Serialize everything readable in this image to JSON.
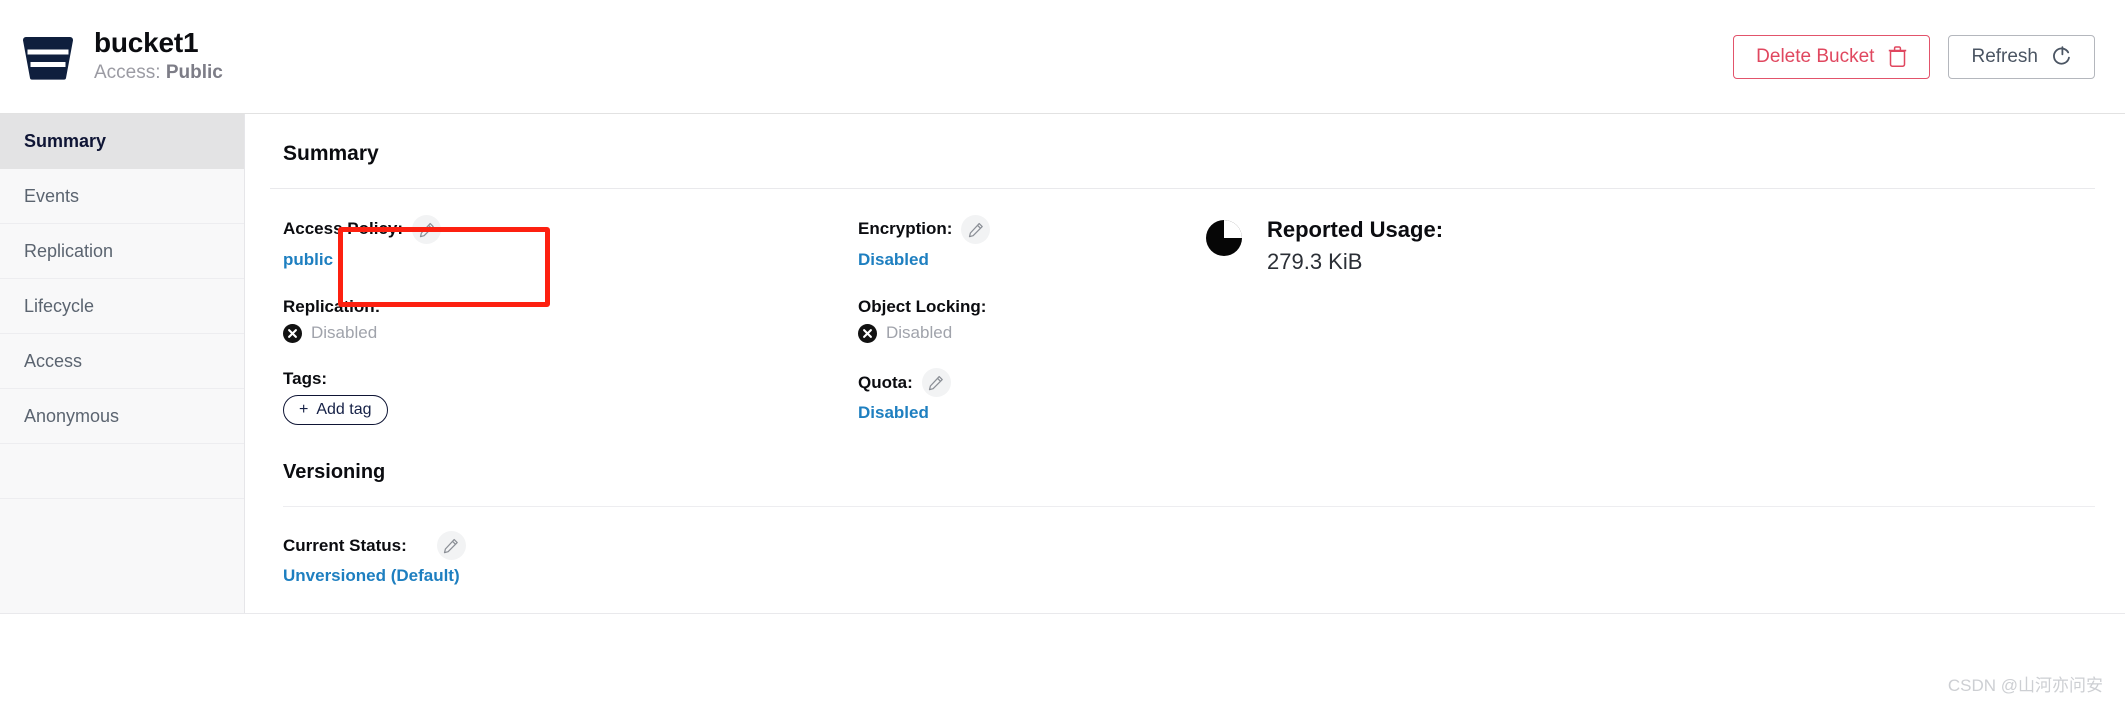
{
  "header": {
    "bucket_icon": "bucket-icon",
    "bucket_name": "bucket1",
    "access_label": "Access:",
    "access_value": "Public",
    "delete_button": "Delete Bucket",
    "delete_icon": "trash-icon",
    "refresh_button": "Refresh",
    "refresh_icon": "refresh-icon"
  },
  "sidebar": {
    "items": [
      {
        "label": "Summary",
        "active": true
      },
      {
        "label": "Events",
        "active": false
      },
      {
        "label": "Replication",
        "active": false
      },
      {
        "label": "Lifecycle",
        "active": false
      },
      {
        "label": "Access",
        "active": false
      },
      {
        "label": "Anonymous",
        "active": false
      }
    ]
  },
  "main": {
    "section_title": "Summary",
    "column_1": {
      "access_policy": {
        "label": "Access Policy:",
        "value": "public",
        "edit_icon": "pencil-icon"
      },
      "replication": {
        "label": "Replication:",
        "value": "Disabled",
        "status_icon": "x-circle-icon"
      },
      "tags": {
        "label": "Tags:",
        "add_tag_button": "Add tag",
        "add_icon": "plus-icon"
      }
    },
    "column_2": {
      "encryption": {
        "label": "Encryption:",
        "value": "Disabled",
        "edit_icon": "pencil-icon"
      },
      "object_locking": {
        "label": "Object Locking:",
        "value": "Disabled",
        "status_icon": "x-circle-icon"
      },
      "quota": {
        "label": "Quota:",
        "value": "Disabled",
        "edit_icon": "pencil-icon"
      }
    },
    "column_3": {
      "reported_usage": {
        "label": "Reported Usage:",
        "value": "279.3 KiB",
        "icon": "pie-chart-icon"
      }
    },
    "versioning": {
      "title": "Versioning",
      "current_status": {
        "label": "Current Status:",
        "value": "Unversioned (Default)",
        "edit_icon": "pencil-icon"
      }
    }
  },
  "annotation": {
    "target": "access-policy-field",
    "color": "#fd2010"
  },
  "watermark": {
    "text": "CSDN @山河亦问安"
  },
  "colors": {
    "link": "#1e7fc0",
    "danger": "#e0475f",
    "brand_navy": "#0f1535",
    "muted": "#a0a3ab",
    "annotation_red": "#fd2010"
  }
}
